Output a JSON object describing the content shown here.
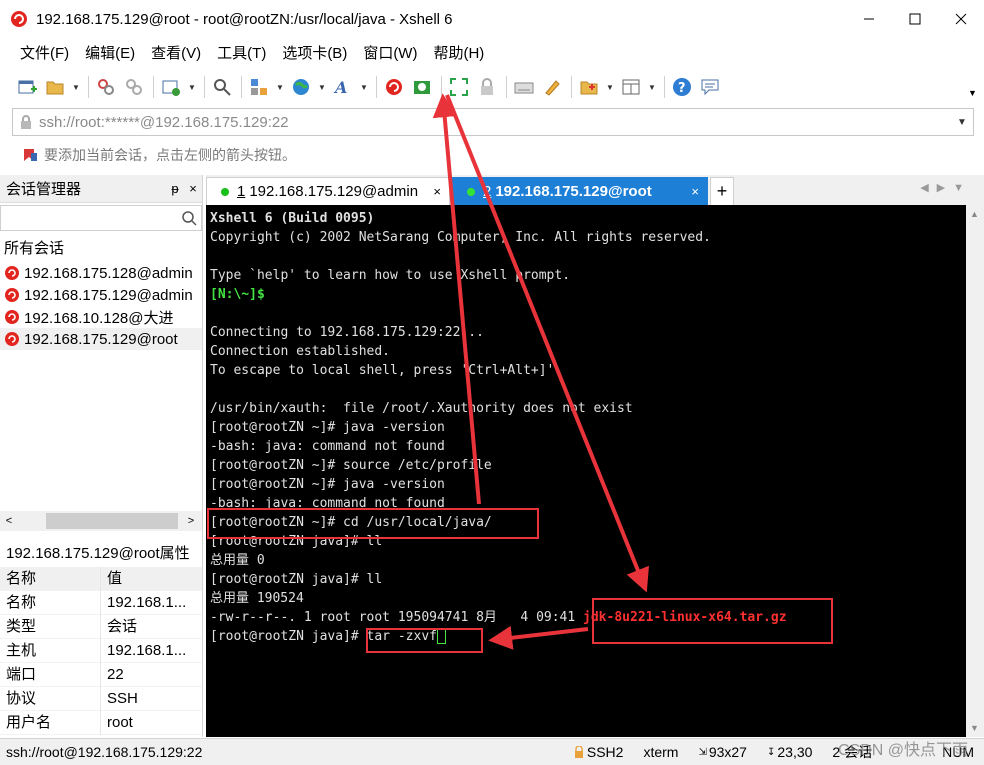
{
  "window": {
    "title": "192.168.175.129@root - root@rootZN:/usr/local/java - Xshell 6"
  },
  "menu": [
    "文件(F)",
    "编辑(E)",
    "查看(V)",
    "工具(T)",
    "选项卡(B)",
    "窗口(W)",
    "帮助(H)"
  ],
  "address": {
    "value": "ssh://root:******@192.168.175.129:22"
  },
  "hint": "要添加当前会话，点击左侧的箭头按钮。",
  "sidebar": {
    "title": "会话管理器",
    "pin": "ᵽ",
    "close": "×",
    "root": "所有会话",
    "sessions": [
      {
        "label": "192.168.175.128@admin"
      },
      {
        "label": "192.168.175.129@admin"
      },
      {
        "label": "192.168.10.128@大进"
      },
      {
        "label": "192.168.175.129@root"
      }
    ]
  },
  "properties": {
    "title": "192.168.175.129@root属性",
    "header": {
      "key": "名称",
      "value": "值"
    },
    "rows": [
      {
        "key": "名称",
        "value": "192.168.1..."
      },
      {
        "key": "类型",
        "value": "会话"
      },
      {
        "key": "主机",
        "value": "192.168.1..."
      },
      {
        "key": "端口",
        "value": "22"
      },
      {
        "key": "协议",
        "value": "SSH"
      },
      {
        "key": "用户名",
        "value": "root"
      }
    ]
  },
  "tabs": [
    {
      "num": "1",
      "label": "192.168.175.129@admin",
      "active": false
    },
    {
      "num": "2",
      "label": "192.168.175.129@root",
      "active": true
    }
  ],
  "terminal": {
    "lines": [
      {
        "text": "Xshell 6 (Build 0095)",
        "style": "bold"
      },
      {
        "text": "Copyright (c) 2002 NetSarang Computer, Inc. All rights reserved.",
        "style": ""
      },
      {
        "text": "",
        "style": ""
      },
      {
        "text": "Type `help' to learn how to use Xshell prompt.",
        "style": ""
      },
      {
        "text": "[N:\\~]$",
        "style": "green"
      },
      {
        "text": "",
        "style": ""
      },
      {
        "text": "Connecting to 192.168.175.129:22...",
        "style": ""
      },
      {
        "text": "Connection established.",
        "style": ""
      },
      {
        "text": "To escape to local shell, press 'Ctrl+Alt+]'.",
        "style": ""
      },
      {
        "text": "",
        "style": ""
      },
      {
        "text": "/usr/bin/xauth:  file /root/.Xauthority does not exist",
        "style": ""
      },
      {
        "text": "[root@rootZN ~]# java -version",
        "style": ""
      },
      {
        "text": "-bash: java: command not found",
        "style": ""
      },
      {
        "text": "[root@rootZN ~]# source /etc/profile",
        "style": ""
      },
      {
        "text": "[root@rootZN ~]# java -version",
        "style": ""
      },
      {
        "text": "-bash: java: command not found",
        "style": ""
      },
      {
        "text": "[root@rootZN ~]# cd /usr/local/java/",
        "style": ""
      },
      {
        "text": "[root@rootZN java]# ll",
        "style": ""
      },
      {
        "text": "总用量 0",
        "style": ""
      },
      {
        "text": "[root@rootZN java]# ll",
        "style": ""
      },
      {
        "text": "总用量 190524",
        "style": ""
      }
    ],
    "file_line": {
      "prefix": "-rw-r--r--. 1 root root 195094741 8月   4 09:41 ",
      "filename": "jdk-8u221-linux-x64.tar.gz"
    },
    "last_prompt": "[root@rootZN java]# tar -zxvf"
  },
  "status": {
    "connection": "ssh://root@192.168.175.129:22",
    "protocol": "SSH2",
    "term": "xterm",
    "size": "93x27",
    "cursor": "23,30",
    "sessions": "2 会话",
    "numlock": "NUM"
  },
  "watermark": "CSDN @快点下雨",
  "colors": {
    "active_tab": "#1e7fd6",
    "terminal_bg": "#000000",
    "prompt_green": "#44e444",
    "annotation_red": "#e8333a"
  }
}
